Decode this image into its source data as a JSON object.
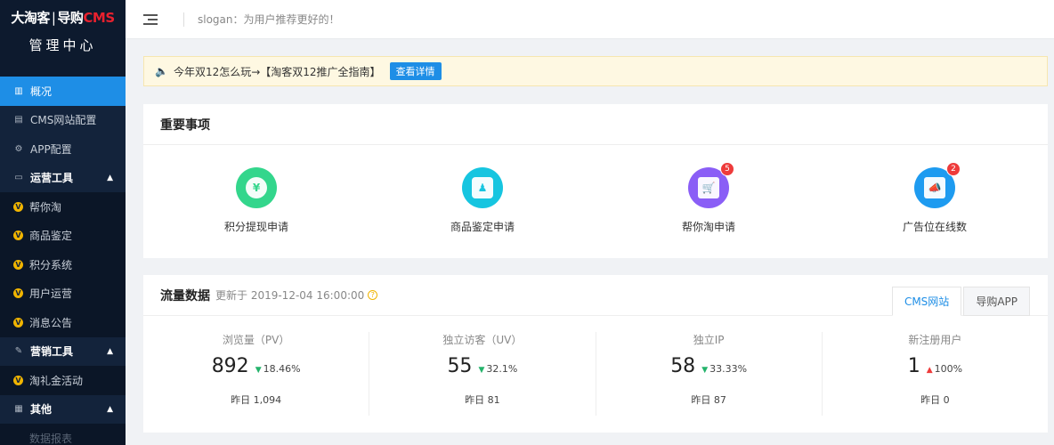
{
  "brand": {
    "logo_main": "大淘客",
    "logo_sep": "|",
    "logo_sub": "导购",
    "logo_cms": "CMS",
    "subtitle": "管理中心"
  },
  "sidebar": {
    "items": [
      {
        "label": "概况",
        "icon": "chart-icon",
        "glyph": "▥"
      },
      {
        "label": "CMS网站配置",
        "icon": "document-icon",
        "glyph": "▤"
      },
      {
        "label": "APP配置",
        "icon": "gear-icon",
        "glyph": "⚙"
      },
      {
        "label": "运营工具",
        "icon": "monitor-icon",
        "glyph": "▭",
        "chevron": "▲"
      },
      {
        "label": "帮你淘",
        "icon": "v-badge-icon",
        "glyph": "V"
      },
      {
        "label": "商品鉴定",
        "icon": "v-badge-icon",
        "glyph": "V"
      },
      {
        "label": "积分系统",
        "icon": "v-badge-icon",
        "glyph": "V"
      },
      {
        "label": "用户运营",
        "icon": "v-badge-icon",
        "glyph": "V"
      },
      {
        "label": "消息公告",
        "icon": "v-badge-icon",
        "glyph": "V"
      },
      {
        "label": "营销工具",
        "icon": "wrench-icon",
        "glyph": "✎",
        "chevron": "▲"
      },
      {
        "label": "淘礼金活动",
        "icon": "v-badge-icon",
        "glyph": "V"
      },
      {
        "label": "其他",
        "icon": "grid-icon",
        "glyph": "▦",
        "chevron": "▲"
      },
      {
        "label": "数据报表"
      }
    ]
  },
  "header": {
    "slogan": "slogan：为用户推荐更好的！"
  },
  "notice": {
    "text": "今年双12怎么玩→【淘客双12推广全指南】",
    "button": "查看详情",
    "icon": "speaker-icon"
  },
  "important": {
    "title": "重要事项",
    "items": [
      {
        "label": "积分提现申请",
        "glyph": "¥",
        "color": "#33d68c"
      },
      {
        "label": "商品鉴定申请",
        "glyph": "♟",
        "color": "#16c5e0"
      },
      {
        "label": "帮你淘申请",
        "glyph": "🛒",
        "color": "#8a5ef6",
        "badge": "5"
      },
      {
        "label": "广告位在线数",
        "glyph": "📣",
        "color": "#1e9bf0",
        "badge": "2"
      }
    ]
  },
  "traffic": {
    "title": "流量数据",
    "updated": "更新于 2019-12-04 16:00:00",
    "help": "?",
    "tabs": [
      "CMS网站",
      "导购APP"
    ],
    "stats": [
      {
        "label": "浏览量（PV）",
        "value": "892",
        "arrow": "▼",
        "change": "18.46%",
        "yesterday": "昨日 1,094"
      },
      {
        "label": "独立访客（UV）",
        "value": "55",
        "arrow": "▼",
        "change": "32.1%",
        "yesterday": "昨日 81"
      },
      {
        "label": "独立IP",
        "value": "58",
        "arrow": "▼",
        "change": "33.33%",
        "yesterday": "昨日 87"
      },
      {
        "label": "新注册用户",
        "value": "1",
        "arrow": "▲",
        "change": "100%",
        "yesterday": "昨日 0"
      }
    ]
  }
}
